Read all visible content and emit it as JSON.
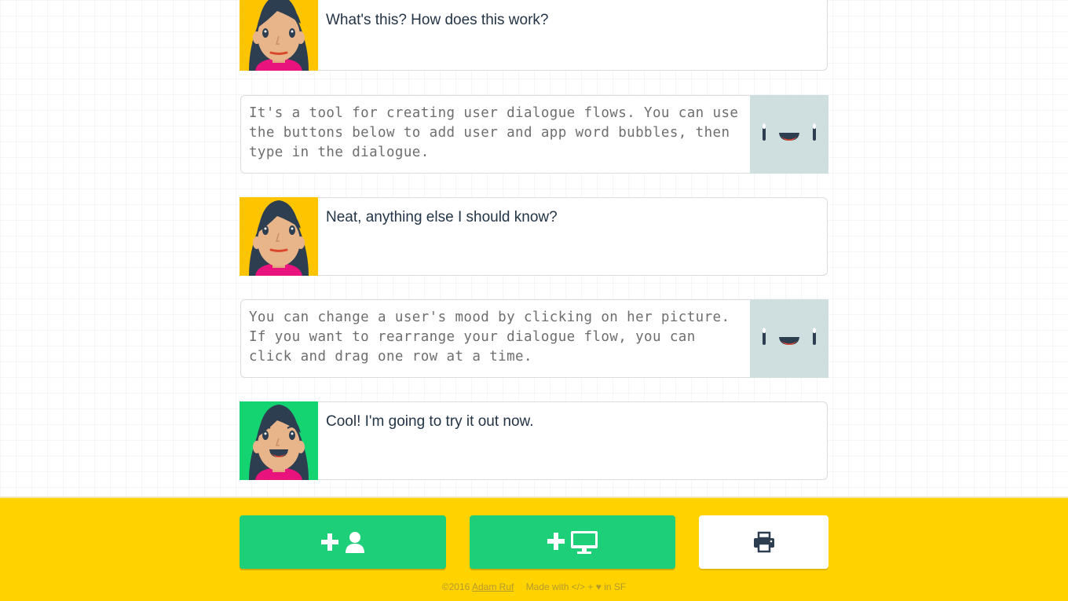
{
  "dialogue": [
    {
      "type": "user",
      "mood": "neutral",
      "bg": "#ffc400",
      "text": "What's this? How does this work?"
    },
    {
      "type": "app",
      "text": "It's a tool for creating user dialogue flows. You can use the buttons below to add user and app word bubbles, then type in the dialogue."
    },
    {
      "type": "user",
      "mood": "neutral",
      "bg": "#ffc400",
      "text": "Neat, anything else I should know?"
    },
    {
      "type": "app",
      "text": "You can change a user's mood by clicking on her picture. If you want to rearrange your dialogue flow, you can click and drag one row at a time."
    },
    {
      "type": "user",
      "mood": "happy",
      "bg": "#14d472",
      "text": "Cool! I'm going to try it out now."
    }
  ],
  "toolbar": {
    "add_user_icon": "plus-user-icon",
    "add_app_icon": "plus-monitor-icon",
    "print_icon": "printer-icon"
  },
  "footer": {
    "copyright": "©2016",
    "author": "Adam Ruf",
    "made_with": "Made with </> + ",
    "heart": "♥",
    "location": " in SF"
  },
  "colors": {
    "bar": "#ffd200",
    "green_button": "#1ccf78",
    "app_face_bg": "#cfdfdf",
    "hair": "#2c3e50",
    "skin": "#e8b48a"
  }
}
